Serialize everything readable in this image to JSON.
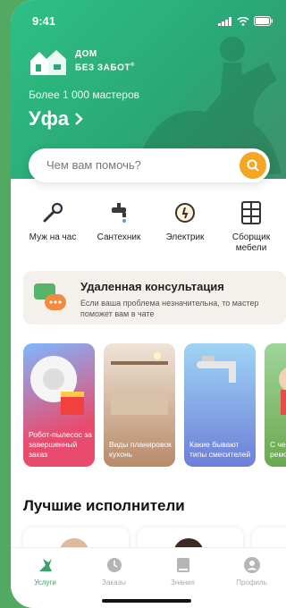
{
  "status": {
    "time": "9:41"
  },
  "brand": {
    "line1": "ДОМ",
    "line2": "БЕЗ ЗАБОТ",
    "mark": "®"
  },
  "hero": {
    "masters": "Более 1 000 мастеров",
    "city": "Уфа"
  },
  "search": {
    "placeholder": "Чем вам помочь?"
  },
  "services": [
    {
      "label": "Муж на час",
      "icon": "wrench-icon"
    },
    {
      "label": "Сантехник",
      "icon": "faucet-icon"
    },
    {
      "label": "Электрик",
      "icon": "power-socket-icon"
    },
    {
      "label": "Сборщик мебели",
      "icon": "furniture-icon"
    }
  ],
  "consult": {
    "title": "Удаленная консультация",
    "desc": "Если ваша проблема незначительна, то мастер поможет вам в чате"
  },
  "stories": [
    {
      "text": "Робот-пылесос за завершенный заказ",
      "color": "#e94b6e"
    },
    {
      "text": "Виды планировок кухонь",
      "color": "#c89a7a"
    },
    {
      "text": "Какие бывают типы смесителей",
      "color": "#6d7fd8"
    },
    {
      "text": "С чего начать ремонт ква",
      "color": "#6aa84f"
    }
  ],
  "best": {
    "title": "Лучшие исполнители"
  },
  "tabs": [
    {
      "label": "Услуги",
      "icon": "services-icon",
      "active": true
    },
    {
      "label": "Заказы",
      "icon": "clock-icon",
      "active": false
    },
    {
      "label": "Знания",
      "icon": "book-icon",
      "active": false
    },
    {
      "label": "Профиль",
      "icon": "profile-icon",
      "active": false
    }
  ],
  "colors": {
    "brand_green": "#2fbf86",
    "accent_orange": "#f5a623",
    "tab_active": "#3aa36a"
  }
}
